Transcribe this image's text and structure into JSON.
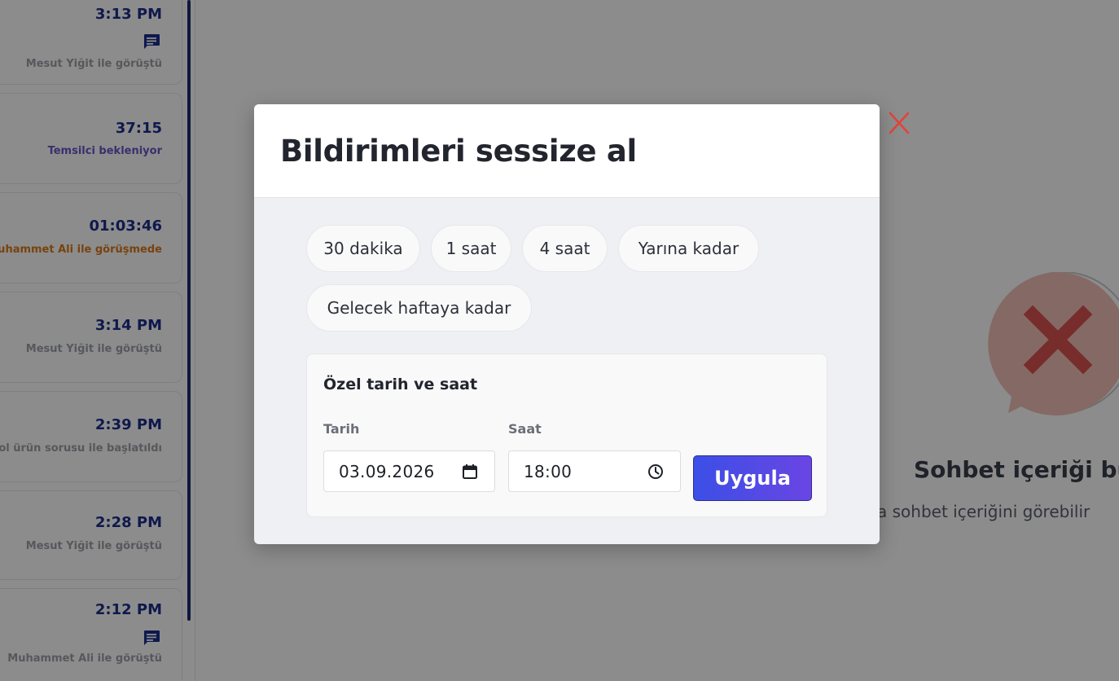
{
  "sidebar": {
    "chats": [
      {
        "time": "3:13 PM",
        "status": "Mesut Yiğit ile görüştü",
        "status_color": "#9da1a8",
        "has_message_icon": true
      },
      {
        "time": "37:15",
        "status": "Temsilci bekleniyor",
        "status_color": "#6b56c8",
        "has_message_icon": false
      },
      {
        "time": "01:03:46",
        "status": "Muhammet Ali ile görüşmede",
        "status_color": "#d97a1c",
        "has_message_icon": false
      },
      {
        "time": "3:14 PM",
        "status": "Mesut Yiğit ile görüştü",
        "status_color": "#9da1a8",
        "has_message_icon": false
      },
      {
        "time": "2:39 PM",
        "status": "lyol ürün sorusu ile başlatıldı",
        "status_color": "#9da1a8",
        "has_message_icon": false
      },
      {
        "time": "2:28 PM",
        "status": "Mesut Yiğit ile görüştü",
        "status_color": "#9da1a8",
        "has_message_icon": false
      },
      {
        "time": "2:12 PM",
        "status": "Muhammet Ali ile görüştü",
        "status_color": "#9da1a8",
        "has_message_icon": true
      }
    ]
  },
  "main": {
    "empty_title": "Sohbet içeriği bul",
    "empty_subtitle": "a sohbet içeriğini görebilir"
  },
  "modal": {
    "title": "Bildirimleri sessize al",
    "presets": [
      "30 dakika",
      "1 saat",
      "4 saat",
      "Yarına kadar",
      "Gelecek haftaya kadar"
    ],
    "custom": {
      "title": "Özel tarih ve saat",
      "date_label": "Tarih",
      "date_value": "03.09.2026",
      "time_label": "Saat",
      "time_value": "18:00",
      "apply_label": "Uygula"
    },
    "close_icon": "close-x-icon"
  },
  "colors": {
    "accent_gradient_start": "#3b4fe6",
    "accent_gradient_end": "#6a45e4",
    "close_red": "#e0453a",
    "time_blue": "#1d2f8c"
  }
}
